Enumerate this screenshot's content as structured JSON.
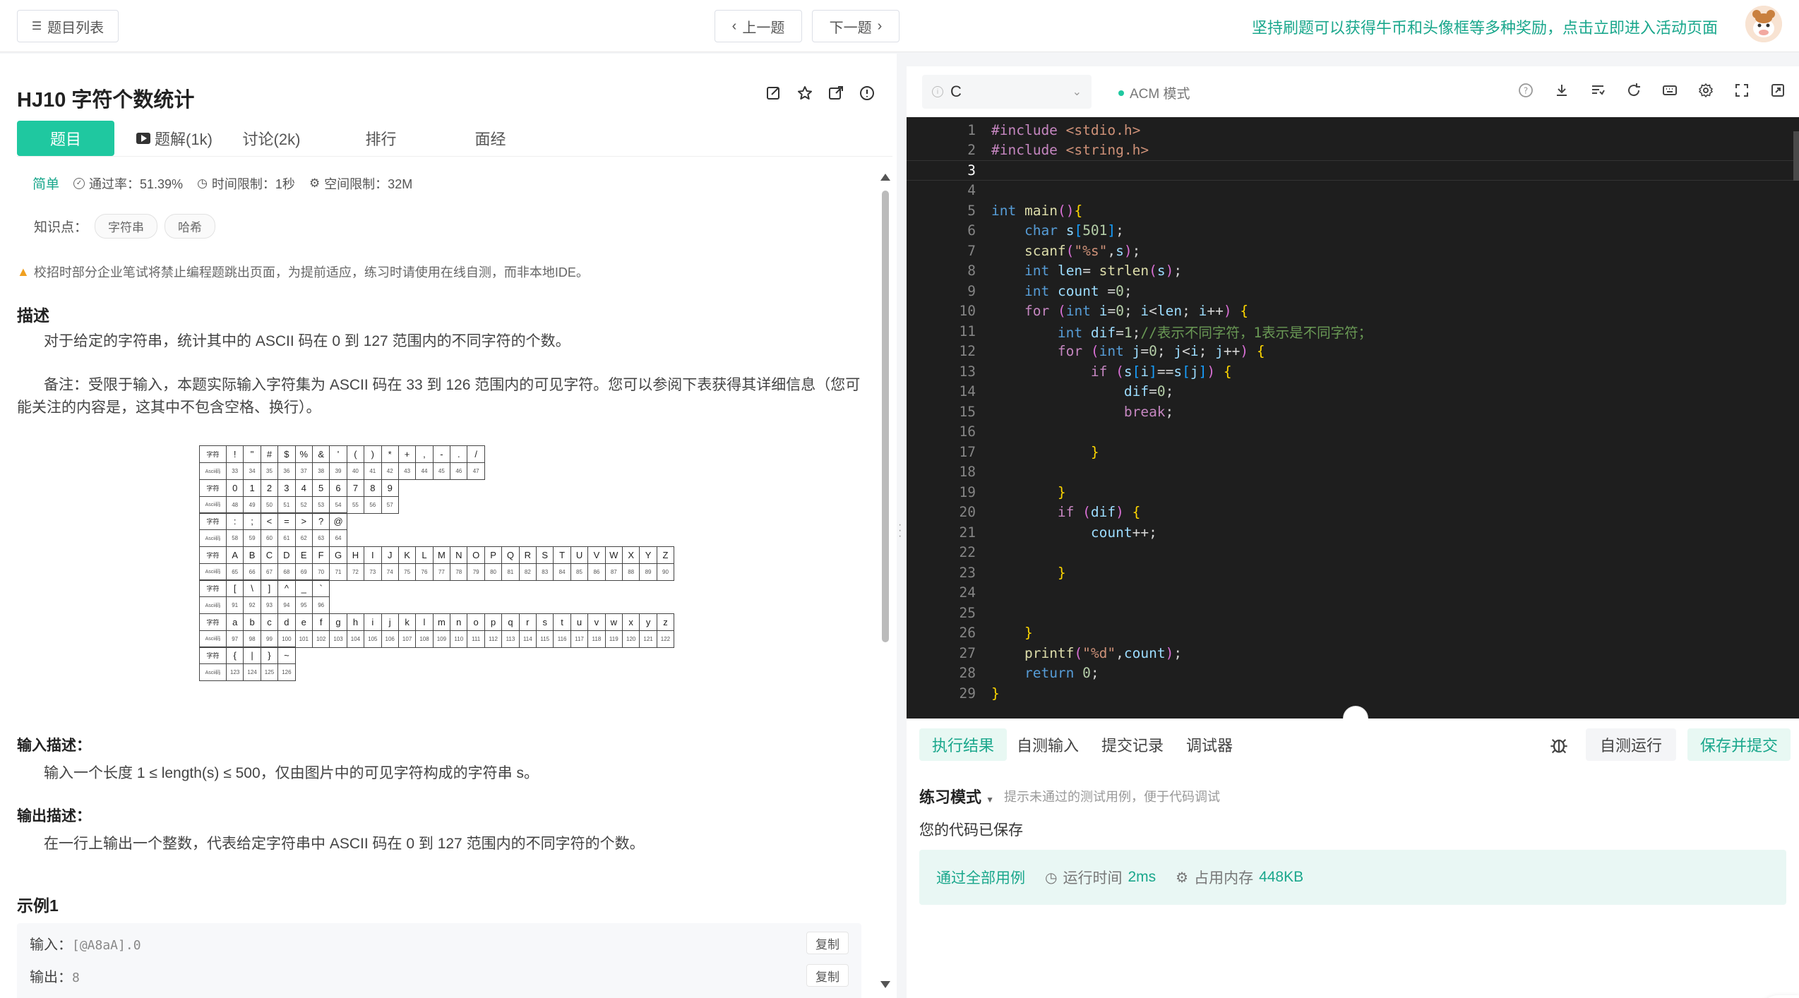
{
  "topbar": {
    "problem_list": "题目列表",
    "prev": "上一题",
    "next": "下一题",
    "promo": "坚持刷题可以获得牛币和头像框等多种奖励，点击立即进入活动页面"
  },
  "problem": {
    "title": "HJ10  字符个数统计",
    "tabs": [
      "题目",
      "题解(1k)",
      "讨论(2k)",
      "排行",
      "面经"
    ],
    "difficulty": "简单",
    "pass_rate": "通过率：51.39%",
    "time_limit": "时间限制：1秒",
    "space_limit": "空间限制：32M",
    "knowledge_label": "知识点：",
    "tags": [
      "字符串",
      "哈希"
    ],
    "warning": "校招时部分企业笔试将禁止编程题跳出页面，为提前适应，练习时请使用在线自测，而非本地IDE。",
    "desc_heading": "描述",
    "desc_1": "对于给定的字符串，统计其中的 ASCII 码在 0 到 127 范围内的不同字符的个数。",
    "desc_2": "备注：受限于输入，本题实际输入字符集为 ASCII 码在 33 到 126 范围内的可见字符。您可以参阅下表获得其详细信息（您可能关注的内容是，这其中不包含空格、换行）。",
    "input_heading": "输入描述：",
    "input_desc": "输入一个长度 1 ≤ length(s) ≤ 500，仅由图片中的可见字符构成的字符串 s。",
    "output_heading": "输出描述：",
    "output_desc": "在一行上输出一个整数，代表给定字符串中 ASCII 码在 0 到 127 范围内的不同字符的个数。",
    "example_heading": "示例1",
    "example_input_label": "输入：",
    "example_input": "[@A8aA].0",
    "example_output_label": "输出：",
    "example_output": "8",
    "copy": "复制"
  },
  "ascii_table": {
    "char_label": "字符",
    "code_label": "Ascii码",
    "blocks": [
      {
        "chars": [
          "!",
          "\"",
          "#",
          "$",
          "%",
          "&",
          "'",
          "(",
          ")",
          "*",
          "+",
          ",",
          "-",
          ".",
          "/"
        ],
        "codes": [
          "33",
          "34",
          "35",
          "36",
          "37",
          "38",
          "39",
          "40",
          "41",
          "42",
          "43",
          "44",
          "45",
          "46",
          "47"
        ]
      },
      {
        "chars": [
          "0",
          "1",
          "2",
          "3",
          "4",
          "5",
          "6",
          "7",
          "8",
          "9"
        ],
        "codes": [
          "48",
          "49",
          "50",
          "51",
          "52",
          "53",
          "54",
          "55",
          "56",
          "57"
        ]
      },
      {
        "chars": [
          ":",
          ";",
          "<",
          "=",
          ">",
          "?",
          "@"
        ],
        "codes": [
          "58",
          "59",
          "60",
          "61",
          "62",
          "63",
          "64"
        ]
      },
      {
        "chars": [
          "A",
          "B",
          "C",
          "D",
          "E",
          "F",
          "G",
          "H",
          "I",
          "J",
          "K",
          "L",
          "M",
          "N",
          "O",
          "P",
          "Q",
          "R",
          "S",
          "T",
          "U",
          "V",
          "W",
          "X",
          "Y",
          "Z"
        ],
        "codes": [
          "65",
          "66",
          "67",
          "68",
          "69",
          "70",
          "71",
          "72",
          "73",
          "74",
          "75",
          "76",
          "77",
          "78",
          "79",
          "80",
          "81",
          "82",
          "83",
          "84",
          "85",
          "86",
          "87",
          "88",
          "89",
          "90"
        ]
      },
      {
        "chars": [
          "[",
          "\\",
          "]",
          "^",
          "_",
          "`"
        ],
        "codes": [
          "91",
          "92",
          "93",
          "94",
          "95",
          "96"
        ]
      },
      {
        "chars": [
          "a",
          "b",
          "c",
          "d",
          "e",
          "f",
          "g",
          "h",
          "i",
          "j",
          "k",
          "l",
          "m",
          "n",
          "o",
          "p",
          "q",
          "r",
          "s",
          "t",
          "u",
          "v",
          "w",
          "x",
          "y",
          "z"
        ],
        "codes": [
          "97",
          "98",
          "99",
          "100",
          "101",
          "102",
          "103",
          "104",
          "105",
          "106",
          "107",
          "108",
          "109",
          "110",
          "111",
          "112",
          "113",
          "114",
          "115",
          "116",
          "117",
          "118",
          "119",
          "120",
          "121",
          "122"
        ]
      },
      {
        "chars": [
          "{",
          "|",
          "}",
          "~"
        ],
        "codes": [
          "123",
          "124",
          "125",
          "126"
        ]
      }
    ]
  },
  "editor": {
    "language": "C",
    "mode": "ACM 模式",
    "lines": [
      "#include <stdio.h>",
      "#include <string.h>",
      "",
      "",
      "int main(){",
      "    char s[501];",
      "    scanf(\"%s\",s);",
      "    int len= strlen(s);",
      "    int count =0;",
      "    for (int i=0; i<len; i++) {",
      "        int dif=1;//表示不同字符，1表示是不同字符；",
      "        for (int j=0; j<i; j++) {",
      "            if (s[i]==s[j]) {",
      "                dif=0;",
      "                break;",
      "",
      "            }",
      "",
      "        }",
      "        if (dif) {",
      "            count++;",
      "",
      "        }",
      "",
      "",
      "    }",
      "    printf(\"%d\",count);",
      "    return 0;",
      "}"
    ],
    "current_line": 3
  },
  "result": {
    "tabs": [
      "执行结果",
      "自测输入",
      "提交记录",
      "调试器"
    ],
    "run": "自测运行",
    "submit": "保存并提交",
    "practice_mode": "练习模式",
    "practice_hint": "提示未通过的测试用例，便于代码调试",
    "saved": "您的代码已保存",
    "pass_all": "通过全部用例",
    "runtime_label": "运行时间",
    "runtime": "2ms",
    "memory_label": "占用内存",
    "memory": "448KB"
  },
  "colors": {
    "accent": "#1fc8a0",
    "accent_text": "#1aa78c",
    "editor_bg": "#1e1e1e"
  }
}
